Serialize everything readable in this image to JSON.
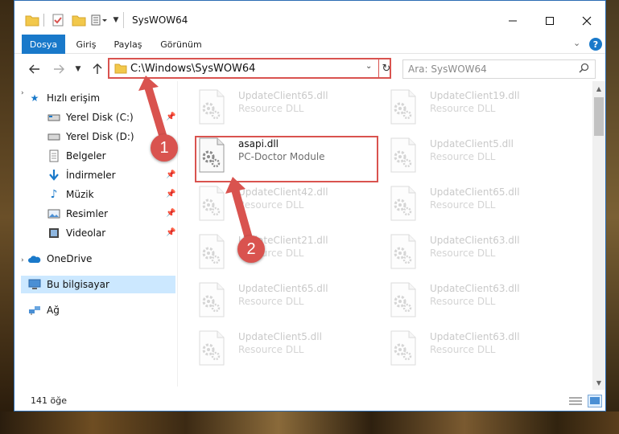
{
  "window": {
    "title": "SysWOW64"
  },
  "ribbon": {
    "tabs": [
      "Dosya",
      "Giriş",
      "Paylaş",
      "Görünüm"
    ],
    "help": "?"
  },
  "address": {
    "path": "C:\\Windows\\SysWOW64"
  },
  "search": {
    "placeholder": "Ara: SysWOW64"
  },
  "sidebar": {
    "quick_access": "Hızlı erişim",
    "items": [
      {
        "label": "Yerel Disk (C:)",
        "icon": "drive-icon",
        "pinned": true
      },
      {
        "label": "Yerel Disk (D:)",
        "icon": "drive-icon",
        "pinned": false
      },
      {
        "label": "Belgeler",
        "icon": "documents-icon",
        "pinned": true
      },
      {
        "label": "İndirmeler",
        "icon": "downloads-icon",
        "pinned": true
      },
      {
        "label": "Müzik",
        "icon": "music-icon",
        "pinned": true
      },
      {
        "label": "Resimler",
        "icon": "pictures-icon",
        "pinned": true
      },
      {
        "label": "Videolar",
        "icon": "videos-icon",
        "pinned": true
      }
    ],
    "onedrive": "OneDrive",
    "this_pc": "Bu bilgisayar",
    "network": "Ağ"
  },
  "files": [
    {
      "name": "UpdateClient65.dll",
      "type": "Resource DLL"
    },
    {
      "name": "UpdateClient19.dll",
      "type": "Resource DLL"
    },
    {
      "name": "asapi.dll",
      "type": "PC-Doctor Module"
    },
    {
      "name": "UpdateClient5.dll",
      "type": "Resource DLL"
    },
    {
      "name": "UpdateClient42.dll",
      "type": "Resource DLL"
    },
    {
      "name": "UpdateClient65.dll",
      "type": "Resource DLL"
    },
    {
      "name": "UpdateClient21.dll",
      "type": "Resource DLL"
    },
    {
      "name": "UpdateClient63.dll",
      "type": "Resource DLL"
    },
    {
      "name": "UpdateClient65.dll",
      "type": "Resource DLL"
    },
    {
      "name": "UpdateClient63.dll",
      "type": "Resource DLL"
    },
    {
      "name": "UpdateClient5.dll",
      "type": "Resource DLL"
    },
    {
      "name": "UpdateClient63.dll",
      "type": "Resource DLL"
    }
  ],
  "status": {
    "count": "141 öğe"
  },
  "annotations": {
    "step1": "1",
    "step2": "2"
  },
  "colors": {
    "accent": "#1979ca",
    "annotation": "#d9534f",
    "selection": "#cce8ff"
  }
}
